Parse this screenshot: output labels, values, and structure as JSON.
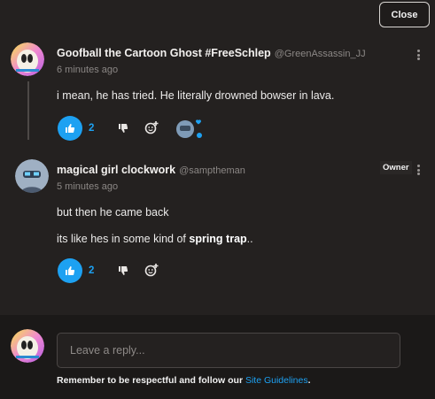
{
  "close_label": "Close",
  "colors": {
    "accent": "#1da1f2",
    "background": "#242120",
    "reply_area": "#1b1918"
  },
  "comments": [
    {
      "author": "Goofball the Cartoon Ghost #FreeSchlep",
      "handle": "@GreenAssassin_JJ",
      "time": "6 minutes ago",
      "lines": [
        "i mean, he has tried. He literally drowned bowser in lava."
      ],
      "likes": "2",
      "avatar_icon": "ghost-avatar-icon",
      "reply_preview_icon": "reply-avatar-icon"
    },
    {
      "author": "magical girl clockwork",
      "handle": "@samptheman",
      "time": "5 minutes ago",
      "badge": "Owner",
      "lines": [
        "but then he came back"
      ],
      "line2_prefix": "its like hes in some kind of ",
      "line2_bold": "spring trap",
      "line2_suffix": "..",
      "likes": "2",
      "avatar_icon": "clockwork-avatar-icon"
    }
  ],
  "reply": {
    "placeholder": "Leave a reply...",
    "guidelines_prefix": "Remember to be respectful and follow our ",
    "guidelines_link": "Site Guidelines",
    "guidelines_suffix": "."
  }
}
